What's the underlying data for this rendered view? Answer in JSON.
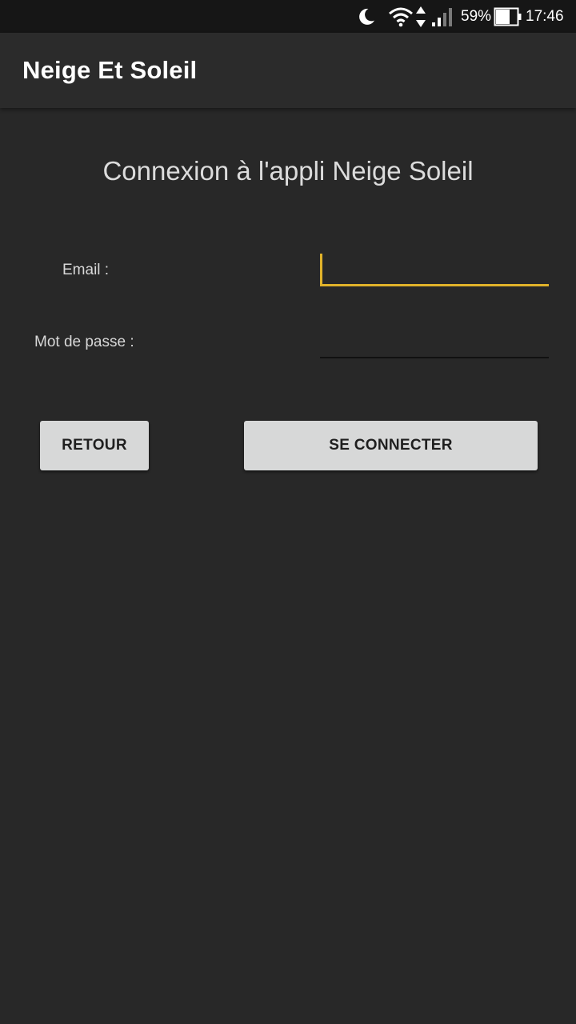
{
  "status_bar": {
    "icons": [
      "moon-icon",
      "wifi-icon",
      "data-arrows-icon",
      "signal-icon",
      "battery-icon"
    ],
    "battery": "59%",
    "time": "17:46"
  },
  "app_bar": {
    "title": "Neige Et Soleil"
  },
  "login": {
    "heading": "Connexion à l'appli Neige Soleil",
    "email_label": "Email :",
    "email_value": "",
    "password_label": "Mot de passe :",
    "password_value": ""
  },
  "buttons": {
    "back_label": "RETOUR",
    "login_label": "SE CONNECTER"
  },
  "colors": {
    "background": "#282828",
    "status_bar": "#161616",
    "app_bar": "#2b2b2b",
    "accent": "#e0b22a",
    "button_bg": "#d7d8d8"
  }
}
